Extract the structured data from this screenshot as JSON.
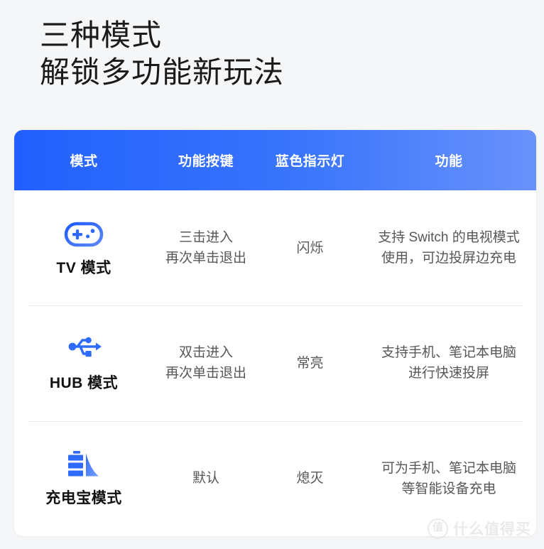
{
  "heading": {
    "line1": "三种模式",
    "line2": "解锁多功能新玩法"
  },
  "colors": {
    "header_gradient_start": "#2160fd",
    "header_gradient_end": "#6992fb",
    "icon_blue": "#2f6bfb",
    "page_background": "#f5f6f7",
    "card_background": "#ffffff",
    "divider": "#e8e9eb",
    "heading_text": "#1a1a1a",
    "body_text": "#555759",
    "watermark": "#e3e4e6"
  },
  "table": {
    "headers": [
      {
        "label": "模式"
      },
      {
        "label": "功能按键"
      },
      {
        "label": "蓝色指示灯"
      },
      {
        "label": "功能"
      }
    ],
    "rows": [
      {
        "icon": "gamepad-icon",
        "mode": "TV 模式",
        "key_line1": "三击进入",
        "key_line2": "再次单击退出",
        "led": "闪烁",
        "func_line1": "支持 Switch 的电视模式",
        "func_line2": "使用，可边投屏边充电"
      },
      {
        "icon": "usb-icon",
        "mode": "HUB 模式",
        "key_line1": "双击进入",
        "key_line2": "再次单击退出",
        "led": "常亮",
        "func_line1": "支持手机、笔记本电脑",
        "func_line2": "进行快速投屏"
      },
      {
        "icon": "power-bank-icon",
        "mode": "充电宝模式",
        "key_line1": "默认",
        "key_line2": "",
        "led": "熄灭",
        "func_line1": "可为手机、笔记本电脑",
        "func_line2": "等智能设备充电"
      }
    ]
  },
  "watermark": {
    "logo_char": "值",
    "text": "什么值得买"
  }
}
